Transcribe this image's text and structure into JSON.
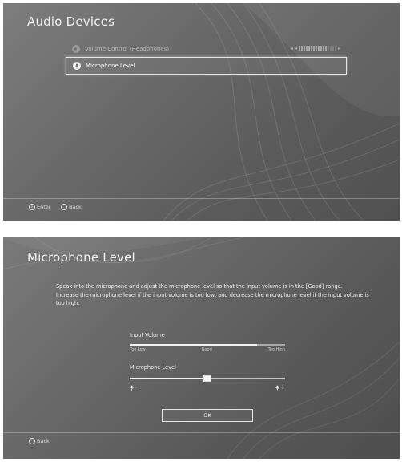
{
  "audio_devices": {
    "title": "Audio Devices",
    "items": [
      {
        "label": "Volume Control (Headphones)",
        "state": "disabled"
      },
      {
        "label": "Microphone Level",
        "state": "selected"
      }
    ],
    "volume_level": 0.75,
    "footer": {
      "enter_label": "Enter",
      "enter_glyph": "⊗",
      "back_label": "Back",
      "back_glyph": "○"
    }
  },
  "microphone_level": {
    "title": "Microphone Level",
    "instructions": [
      "Speak into the microphone and adjust the microphone level so that the input volume is in the [Good] range.",
      "Increase the microphone level if the input volume is too low, and decrease the microphone level if the input volume is too high."
    ],
    "input_volume": {
      "label": "Input Volume",
      "scale": [
        "Too Low",
        "Good",
        "Too High"
      ],
      "level": 0.82
    },
    "mic_level": {
      "label": "Microphone Level",
      "min_symbol": "−",
      "max_symbol": "+",
      "min_icon": "microphone-icon",
      "max_icon": "microphone-icon",
      "value": 0.5
    },
    "ok_label": "OK",
    "footer": {
      "back_label": "Back",
      "back_glyph": "○"
    }
  }
}
